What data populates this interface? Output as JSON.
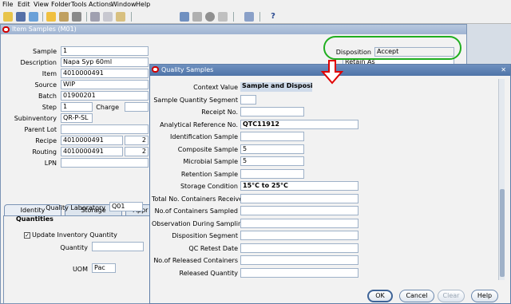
{
  "menu": [
    "File",
    "Edit",
    "View",
    "Folder",
    "Tools",
    "Actions",
    "Window",
    "Help"
  ],
  "toolbar_icons": [
    "open-folder-icon",
    "save-icon",
    "navigate-icon",
    "zoom-icon",
    "find-icon",
    "print-icon",
    "cut-icon",
    "copy-icon",
    "paste-icon",
    "clear-icon",
    "delete-icon",
    "edit-icon",
    "attachment-icon",
    "help-icon"
  ],
  "item_samples": {
    "title": "Item Samples (M01)",
    "fields": {
      "sample": {
        "label": "Sample",
        "value": "1"
      },
      "description": {
        "label": "Description",
        "value": "Napa Syp 60ml"
      },
      "item": {
        "label": "Item",
        "value": "4010000491"
      },
      "source": {
        "label": "Source",
        "value": "WIP"
      },
      "batch": {
        "label": "Batch",
        "value": "01900201"
      },
      "step": {
        "label": "Step",
        "value": "1"
      },
      "charge": {
        "label": "Charge",
        "value": ""
      },
      "subinventory": {
        "label": "Subinventory",
        "value": "QR-P-SL"
      },
      "parent_lot": {
        "label": "Parent Lot",
        "value": ""
      },
      "recipe": {
        "label": "Recipe",
        "value": "4010000491",
        "version": "2"
      },
      "routing": {
        "label": "Routing",
        "value": "4010000491",
        "version": "2"
      },
      "lpn": {
        "label": "LPN",
        "value": ""
      }
    },
    "disposition": {
      "label": "Disposition",
      "value": "Accept"
    },
    "retain_as": {
      "label": "Retain As",
      "value": ""
    },
    "tabs": [
      "Identity",
      "Storage",
      "Appr"
    ],
    "identity": {
      "quality_laboratory": {
        "label": "Quality Laboratory",
        "value": "Q01"
      },
      "quantities_heading": "Quantities",
      "update_inventory_quantity": {
        "label": "Update Inventory Quantity",
        "checked": true
      },
      "quantity": {
        "label": "Quantity",
        "value": ""
      },
      "uom": {
        "label": "UOM",
        "value": "Pac"
      }
    }
  },
  "quality_samples": {
    "title": "Quality Samples",
    "fields": [
      {
        "label": "Context Value",
        "value": "Sample and Disposition",
        "kind": "selected"
      },
      {
        "label": "Sample Quantity Segment",
        "value": "",
        "kind": "small"
      },
      {
        "label": "Receipt No.",
        "value": "",
        "kind": "medium"
      },
      {
        "label": "Analytical Reference No.",
        "value": "QTC11912",
        "kind": "bold"
      },
      {
        "label": "Identification Sample",
        "value": "",
        "kind": "medium"
      },
      {
        "label": "Composite Sample",
        "value": "5",
        "kind": "medium"
      },
      {
        "label": "Microbial Sample",
        "value": "5",
        "kind": "medium"
      },
      {
        "label": "Retention Sample",
        "value": "",
        "kind": "medium"
      },
      {
        "label": "Storage Condition",
        "value": "15°C to 25°C",
        "kind": "bold"
      },
      {
        "label": "Total No. Containers Received",
        "value": "",
        "kind": "long"
      },
      {
        "label": "No.of Containers Sampled",
        "value": "",
        "kind": "long"
      },
      {
        "label": "Observation During Sampling",
        "value": "",
        "kind": "long"
      },
      {
        "label": "Disposition Segment",
        "value": "",
        "kind": "long"
      },
      {
        "label": "QC Retest Date",
        "value": "",
        "kind": "long"
      },
      {
        "label": "No.of Released Containers",
        "value": "",
        "kind": "long"
      },
      {
        "label": "Released Quantity",
        "value": "",
        "kind": "long"
      }
    ],
    "buttons": {
      "ok": "OK",
      "cancel": "Cancel",
      "clear": "Clear",
      "help": "Help"
    }
  },
  "colors": {
    "highlight_oval": "#1fae1f",
    "arrow": "#e00000",
    "titlebar_active": "#4f74a8"
  }
}
